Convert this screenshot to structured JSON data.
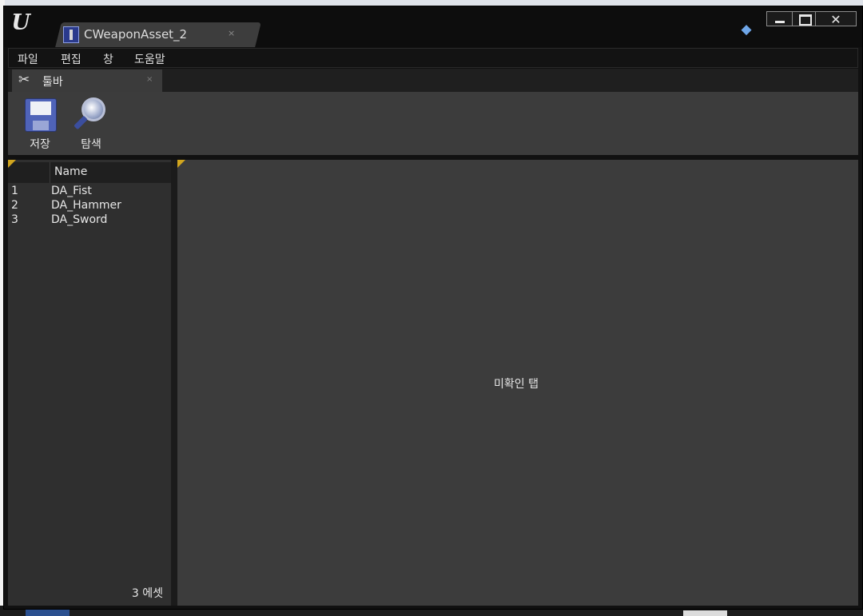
{
  "window": {
    "tab_title": "CWeaponAsset_2",
    "tab_close": "×",
    "close_glyph": "✕"
  },
  "menu": {
    "items": [
      "파일",
      "편집",
      "창",
      "도움말"
    ]
  },
  "toolbar_tab": {
    "label": "툴바",
    "close": "×"
  },
  "toolbar": {
    "buttons": [
      {
        "label": "저장",
        "icon": "save-icon"
      },
      {
        "label": "탐색",
        "icon": "browse-icon"
      }
    ]
  },
  "asset_list": {
    "column_header": "Name",
    "rows": [
      {
        "num": "1",
        "name": "DA_Fist"
      },
      {
        "num": "2",
        "name": "DA_Hammer"
      },
      {
        "num": "3",
        "name": "DA_Sword"
      }
    ],
    "count_text": "3 에셋"
  },
  "details_panel": {
    "placeholder": "미확인 탭"
  },
  "colors": {
    "accent_corner": "#d1a51e",
    "panel_bg": "#3c3c3c",
    "asset_icon": "#2a3a8c"
  }
}
